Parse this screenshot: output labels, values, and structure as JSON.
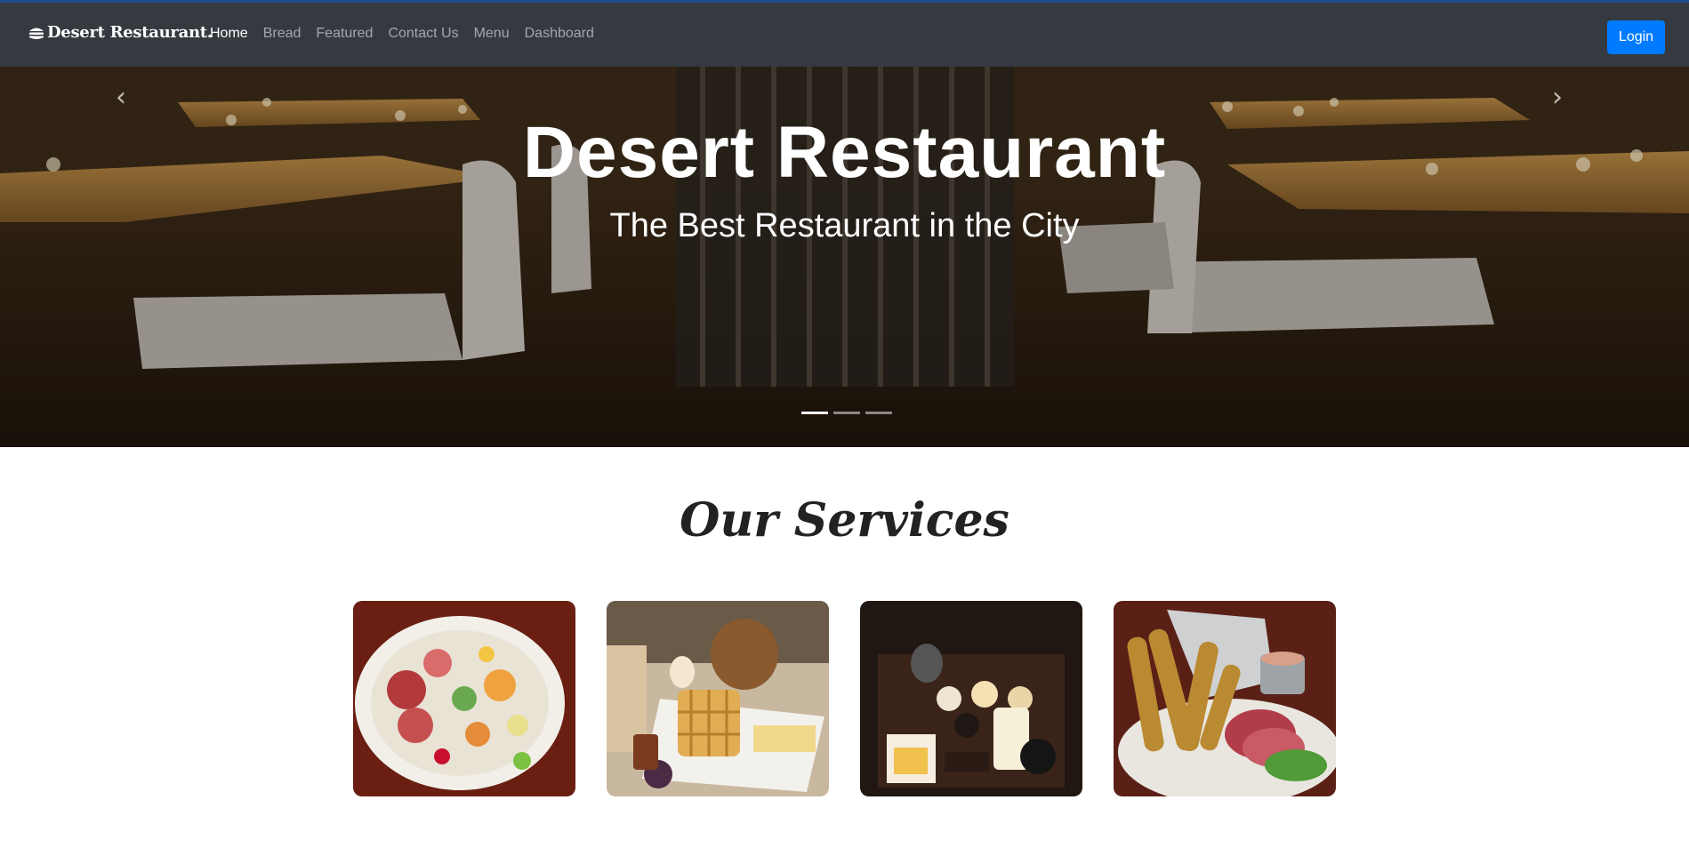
{
  "navbar": {
    "brand": "Desert Restaurant.",
    "brand_icon": "burger-icon",
    "links": [
      {
        "label": "Home",
        "active": true
      },
      {
        "label": "Bread",
        "active": false
      },
      {
        "label": "Featured",
        "active": false
      },
      {
        "label": "Contact Us",
        "active": false
      },
      {
        "label": "Menu",
        "active": false
      },
      {
        "label": "Dashboard",
        "active": false
      }
    ],
    "login_label": "Login"
  },
  "hero": {
    "title": "Desert Restaurant",
    "subtitle": "The Best Restaurant in the City",
    "prev_icon": "chevron-left-icon",
    "next_icon": "chevron-right-icon",
    "slides_count": 3,
    "active_slide": 1
  },
  "services": {
    "title": "Our Services",
    "cards": [
      {
        "name": "antipasto-platter-image"
      },
      {
        "name": "breakfast-waffle-image"
      },
      {
        "name": "japanese-set-image"
      },
      {
        "name": "fried-platter-image"
      }
    ]
  },
  "colors": {
    "navbar_bg": "#343a40",
    "accent": "#007bff"
  }
}
